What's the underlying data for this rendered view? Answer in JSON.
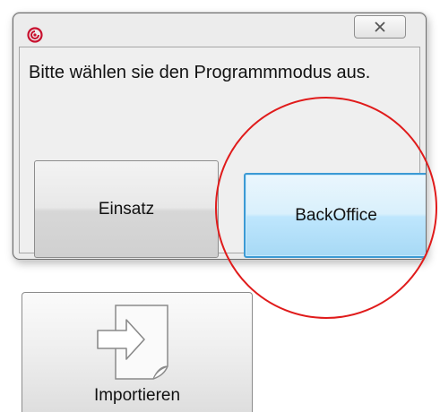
{
  "dialog": {
    "app_icon": "app-logo-icon",
    "close_icon": "close-x-icon",
    "message": "Bitte wählen sie den Programmmodus aus.",
    "buttons": {
      "einsatz": "Einsatz",
      "backoffice": "BackOffice"
    }
  },
  "annotation": {
    "color": "#e01b1b"
  },
  "import_tile": {
    "icon": "import-document-icon",
    "label": "Importieren"
  },
  "colors": {
    "dialog_bg": "#ececec",
    "focus_border": "#3c9ad4",
    "app_icon_accent": "#c8102e"
  }
}
